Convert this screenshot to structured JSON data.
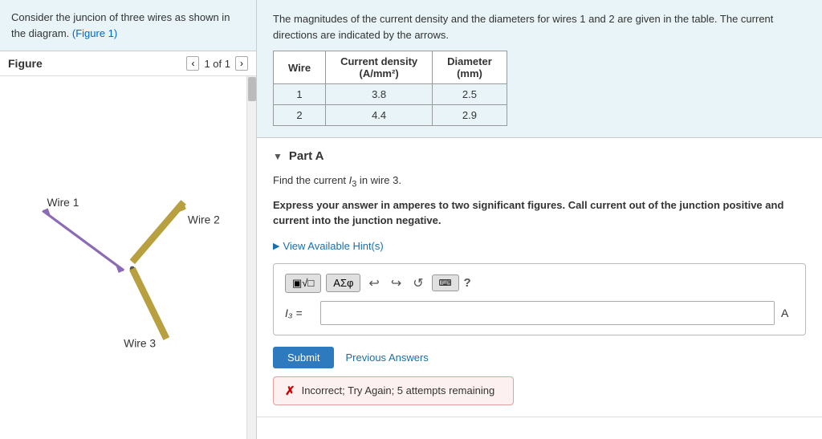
{
  "left": {
    "problem_text": "Consider the juncion of three wires as shown in the diagram.",
    "figure_link": "(Figure 1)",
    "figure_title": "Figure",
    "nav_prev": "‹",
    "nav_of": "1 of 1",
    "nav_next": "›"
  },
  "right": {
    "problem_description": "The magnitudes of the current density and the diameters for wires 1 and 2 are given in the table. The current directions are indicated by the arrows.",
    "table": {
      "headers": [
        "Wire",
        "Current density\n(A/mm²)",
        "Diameter\n(mm)"
      ],
      "rows": [
        [
          "1",
          "3.8",
          "2.5"
        ],
        [
          "2",
          "4.4",
          "2.9"
        ]
      ]
    },
    "part_label": "Part A",
    "find_text": "Find the current I₃ in wire 3.",
    "express_text": "Express your answer in amperes to two significant figures. Call current out of the junction positive and current into the junction negative.",
    "hint_label": "View Available Hint(s)",
    "toolbar": {
      "format_btn": "▣√□",
      "greek_btn": "ΑΣφ",
      "undo_label": "↩",
      "redo_label": "↪",
      "reset_label": "↺",
      "keyboard_label": "⌨",
      "help_label": "?"
    },
    "equation_label": "I₃ =",
    "unit_label": "A",
    "submit_label": "Submit",
    "prev_answers_label": "Previous Answers",
    "error_text": "Incorrect; Try Again; 5 attempts remaining"
  }
}
